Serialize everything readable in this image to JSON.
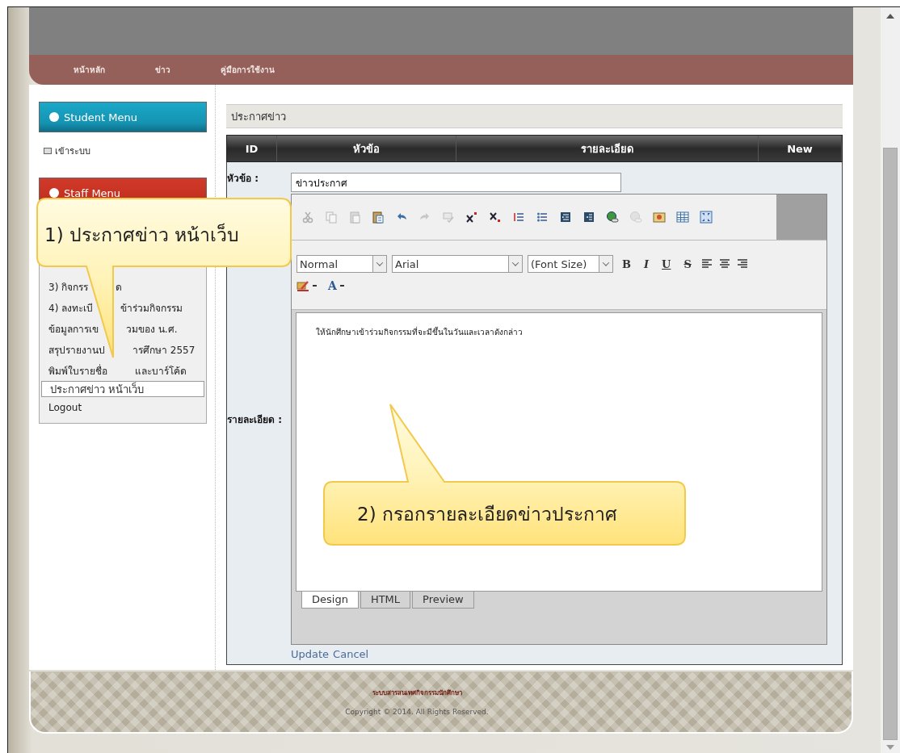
{
  "nav": {
    "items": [
      "หน้าหลัก",
      "ข่าว",
      "คู่มือการใช้งาน"
    ]
  },
  "sidebar": {
    "student_menu": {
      "title": "Student Menu",
      "items": [
        "เข้าระบบ"
      ]
    },
    "staff_menu": {
      "title": "Staff Menu",
      "items": [
        {
          "parts": [
            "3) กิจกรร",
            "ด"
          ],
          "selected": false
        },
        {
          "parts": [
            "4) ลงทะเบี",
            "ข้าร่วมกิจกรรม"
          ],
          "selected": false
        },
        {
          "parts": [
            "ข้อมูลการเข",
            "วมของ น.ศ."
          ],
          "selected": false
        },
        {
          "parts": [
            "สรุปรายงานป",
            "ารศึกษา 2557"
          ],
          "selected": false
        },
        {
          "parts": [
            "พิมพ์ใบรายชื่อ",
            "และบาร์โค้ด"
          ],
          "selected": false
        },
        {
          "parts": [
            "ประกาศข่าว หน้าเว็บ"
          ],
          "selected": true
        },
        {
          "parts": [
            "Logout"
          ],
          "selected": false
        }
      ]
    }
  },
  "content": {
    "title": "ประกาศข่าว",
    "columns": [
      "ID",
      "หัวข้อ",
      "รายละเอียด",
      "New"
    ],
    "form": {
      "subject_label": "หัวข้อ :",
      "subject_value": "ข่าวประกาศ",
      "detail_label": "รายละเอียด :",
      "editor": {
        "tools": [
          {
            "kind": "cut",
            "disabled": true
          },
          {
            "kind": "copy",
            "disabled": true
          },
          {
            "kind": "paste",
            "disabled": true
          },
          {
            "kind": "paste-text",
            "disabled": false
          },
          {
            "kind": "undo",
            "disabled": false
          },
          {
            "kind": "redo",
            "disabled": true
          },
          {
            "kind": "spellcheck",
            "disabled": true
          },
          {
            "kind": "superscript",
            "disabled": false
          },
          {
            "kind": "subscript",
            "disabled": false
          },
          {
            "kind": "numbered-list",
            "disabled": false
          },
          {
            "kind": "bulleted-list",
            "disabled": false
          },
          {
            "kind": "outdent",
            "disabled": false
          },
          {
            "kind": "indent",
            "disabled": false
          },
          {
            "kind": "link",
            "disabled": false
          },
          {
            "kind": "unlink",
            "disabled": true
          },
          {
            "kind": "image",
            "disabled": false
          },
          {
            "kind": "table",
            "disabled": false
          },
          {
            "kind": "fullscreen",
            "disabled": false
          }
        ],
        "selects": [
          "Normal",
          "Arial",
          "(Font Size)"
        ],
        "style_buttons": [
          {
            "kind": "bold",
            "label": "B"
          },
          {
            "kind": "italic",
            "label": "I"
          },
          {
            "kind": "underline",
            "label": "U"
          },
          {
            "kind": "strike",
            "label": "S"
          }
        ],
        "align_tools": [
          {
            "kind": "left"
          },
          {
            "kind": "center"
          },
          {
            "kind": "right"
          }
        ],
        "color_tools": [
          {
            "kind": "highlight"
          },
          {
            "kind": "font-color",
            "label": "A"
          }
        ],
        "text": "ให้นักศึกษาเข้าร่วมกิจกรรมที่จะมีขึ้นในวันและเวลาดังกล่าว",
        "tabs": [
          {
            "label": "Design",
            "selected": true
          },
          {
            "label": "HTML",
            "selected": false
          },
          {
            "label": "Preview",
            "selected": false
          }
        ]
      },
      "links": [
        "Update",
        "Cancel"
      ]
    }
  },
  "footer": {
    "title": "ระบบสารสนเทศกิจกรรมนักศึกษา",
    "copyright": "Copyright © 2014. All Rights Reserved."
  },
  "callouts": [
    {
      "text": "1) ประกาศข่าว หน้าเว็บ"
    },
    {
      "text": "2) กรอกรายละเอียดข่าวประกาศ"
    }
  ]
}
